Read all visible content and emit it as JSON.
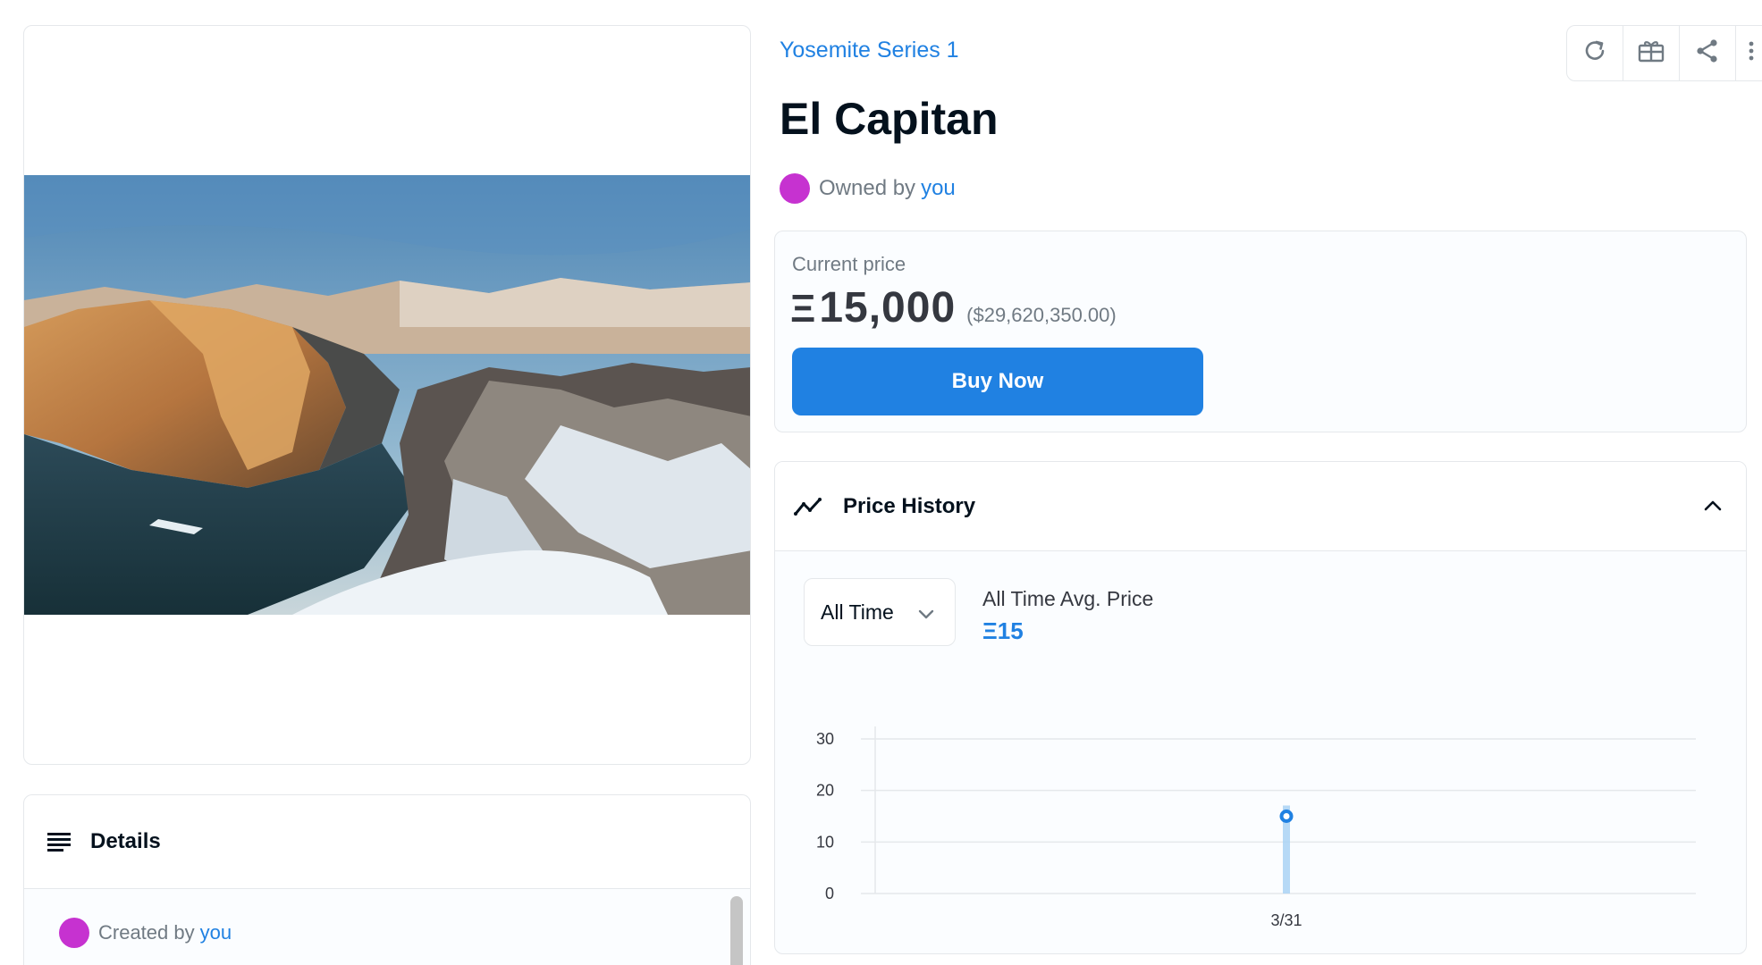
{
  "collection": {
    "name": "Yosemite Series 1"
  },
  "asset": {
    "title": "El Capitan",
    "owner_prefix": "Owned by",
    "owner_name": "you"
  },
  "toolbar": {
    "items": [
      "refresh-icon",
      "gift-icon",
      "share-icon",
      "more-icon"
    ]
  },
  "price": {
    "label": "Current price",
    "currency_symbol": "Ξ",
    "value": "15,000",
    "usd": "($29,620,350.00)",
    "buy_label": "Buy Now"
  },
  "price_history": {
    "title": "Price History",
    "range_selected": "All Time",
    "avg_label": "All Time Avg. Price",
    "avg_value": "Ξ15"
  },
  "details": {
    "title": "Details",
    "creator_prefix": "Created by",
    "creator_name": "you"
  },
  "colors": {
    "accent": "#2081e2",
    "avatar": "#c632d0",
    "muted_text": "#707a83",
    "border": "#e5e8eb"
  },
  "chart_data": {
    "type": "line",
    "title": "",
    "xlabel": "",
    "ylabel": "",
    "categories": [
      "3/31"
    ],
    "series": [
      {
        "values": [
          15
        ]
      }
    ],
    "yticks": [
      0,
      10,
      20,
      30
    ],
    "ylim": [
      0,
      30
    ],
    "grid": true
  }
}
